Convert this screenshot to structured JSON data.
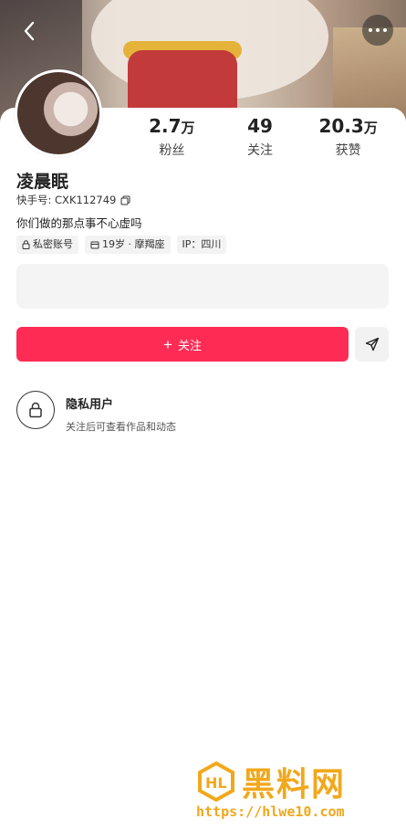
{
  "header": {
    "back_icon": "chevron-left-icon",
    "more_icon": "more-horizontal-icon"
  },
  "profile": {
    "name": "凌晨眠",
    "id_label": "快手号: CXK112749",
    "bio": "你们做的那点事不心虚吗",
    "tags": [
      {
        "icon": "lock-icon",
        "label": "私密账号"
      },
      {
        "icon": "calendar-icon",
        "label": "19岁 · 摩羯座"
      },
      {
        "icon": "",
        "label": "IP：四川"
      }
    ]
  },
  "stats": [
    {
      "num": "2.7",
      "unit": "万",
      "label": "粉丝"
    },
    {
      "num": "49",
      "unit": "",
      "label": "关注"
    },
    {
      "num": "20.3",
      "unit": "万",
      "label": "获赞"
    }
  ],
  "actions": {
    "follow_label": "关注",
    "share_icon": "send-icon"
  },
  "private_notice": {
    "title": "隐私用户",
    "subtitle": "关注后可查看作品和动态"
  },
  "watermark": {
    "brand": "黑料网",
    "url": "https://hlwe10.com"
  },
  "colors": {
    "accent": "#fe2c55",
    "watermark": "#f1a81c"
  }
}
